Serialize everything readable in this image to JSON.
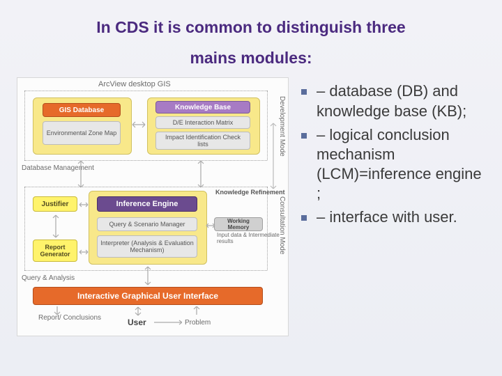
{
  "title_line1": "In CDS it is common to distinguish three",
  "title_line2": "mains modules:",
  "bullets": [
    "– database (DB) and knowledge base (KB);",
    "– logical conclusion mechanism (LCM)=inference engine ;",
    "– interface with user."
  ],
  "diagram": {
    "top_label": "ArcView desktop GIS",
    "side_right_top": "Development Mode",
    "side_right_mid": "Consultation Mode",
    "side_left_mid": "Database Management",
    "side_left_bottom": "Query & Analysis",
    "gis_db": "GIS Database",
    "env_zone": "Environmental\nZone Map",
    "kb": "Knowledge Base",
    "de_matrix": "D/E Interaction Matrix",
    "impact": "Impact Identification\nCheck lists",
    "justifier": "Justifier",
    "inference": "Inference Engine",
    "refinement_label": "Knowledge\nRefinement",
    "query_mgr": "Query & Scenario Manager",
    "interpreter": "Interpreter (Analysis &\nEvaluation Mechanism)",
    "working_mem": "Working Memory",
    "working_sub": "Input data &\nIntermediate results",
    "report": "Report\nGenerator",
    "igui": "Interactive Graphical User Interface",
    "report_conclusions": "Report/\nConclusions",
    "user": "User",
    "problem": "Problem"
  }
}
